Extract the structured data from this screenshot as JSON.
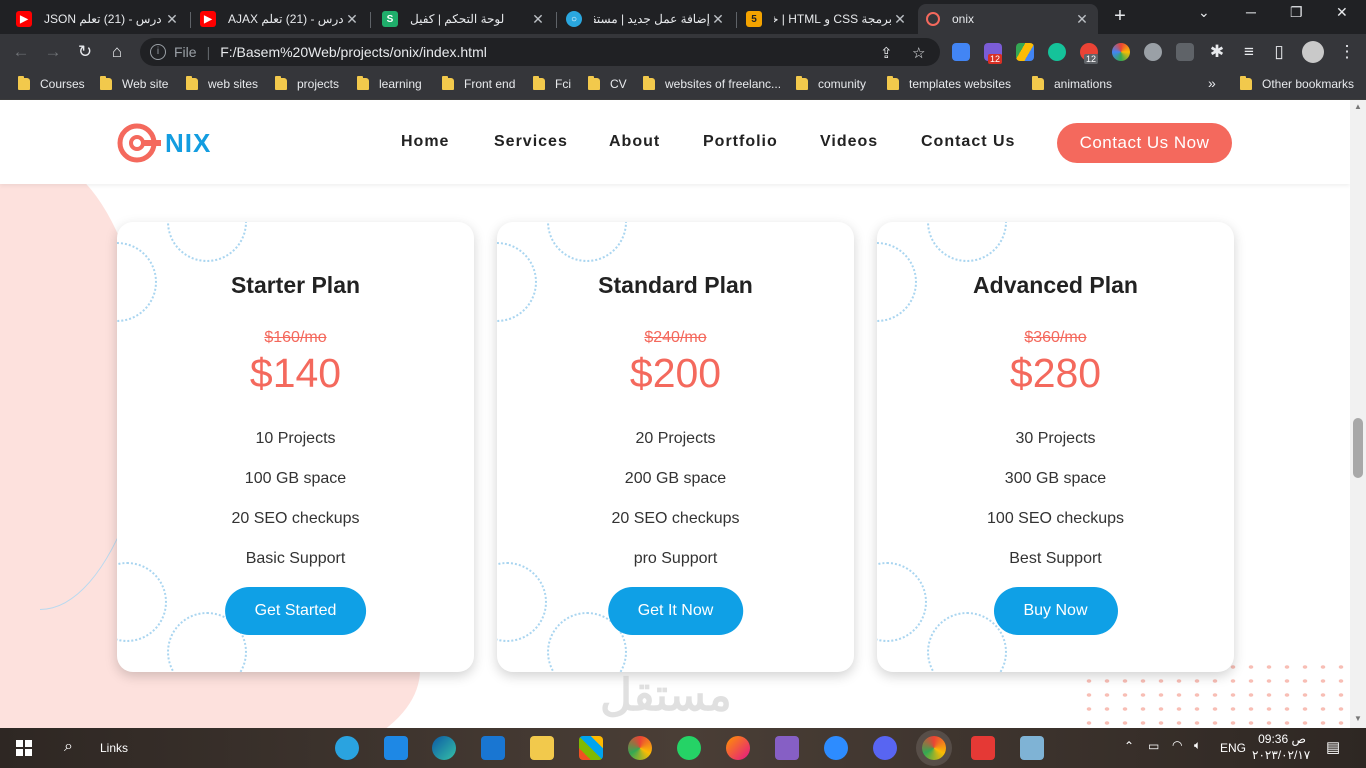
{
  "browser": {
    "tabs": [
      {
        "title": "درس - (21) تعلم JSON",
        "icon": "youtube-icon",
        "color": "#ff0000"
      },
      {
        "title": "درس - (21) تعلم AJAX",
        "icon": "youtube-icon",
        "color": "#ff0000"
      },
      {
        "title": "لوحة التحكم | كفيل",
        "icon": "kafiil-icon",
        "color": "#1fae6b"
      },
      {
        "title": "إضافة عمل جديد | مستقل",
        "icon": "mostaql-icon",
        "color": "#2aa7df"
      },
      {
        "title": "برمجة CSS و HTML | خمسات",
        "icon": "khamsat-icon",
        "color": "#f4a300"
      },
      {
        "title": "onix",
        "icon": "onix-icon",
        "color": "#f4695d"
      }
    ],
    "address": {
      "scheme": "File",
      "url": "F:/Basem%20Web/projects/onix/index.html"
    },
    "bookmarks": [
      "Courses",
      "Web site",
      "web sites",
      "projects",
      "learning",
      "Front end",
      "Fci",
      "CV",
      "websites of freelanc...",
      "comunity",
      "templates websites",
      "animations"
    ],
    "bookmarks_overflow": "»",
    "other_bookmarks": "Other bookmarks",
    "ext_badges": [
      "12",
      "12"
    ]
  },
  "site": {
    "brand": "NIX",
    "nav": [
      "Home",
      "Services",
      "About",
      "Portfolio",
      "Videos",
      "Contact Us"
    ],
    "cta": "Contact Us Now"
  },
  "plans": [
    {
      "name": "Starter Plan",
      "old_price": "$160/mo",
      "price": "$140",
      "features": [
        "10 Projects",
        "100 GB space",
        "20 SEO checkups",
        "Basic Support"
      ],
      "button": "Get Started"
    },
    {
      "name": "Standard Plan",
      "old_price": "$240/mo",
      "price": "$200",
      "features": [
        "20 Projects",
        "200 GB space",
        "20 SEO checkups",
        "pro Support"
      ],
      "button": "Get It Now"
    },
    {
      "name": "Advanced Plan",
      "old_price": "$360/mo",
      "price": "$280",
      "features": [
        "30 Projects",
        "300 GB space",
        "100 SEO checkups",
        "Best Support"
      ],
      "button": "Buy Now"
    }
  ],
  "watermark": "مستقل",
  "taskbar": {
    "search_label": "Links",
    "language": "ENG",
    "time": "09:36 ص",
    "date": "٢٠٢٣/٠٢/١٧"
  },
  "colors": {
    "accent": "#f4695d",
    "primary": "#0fa0e6",
    "brand": "#139de0"
  }
}
